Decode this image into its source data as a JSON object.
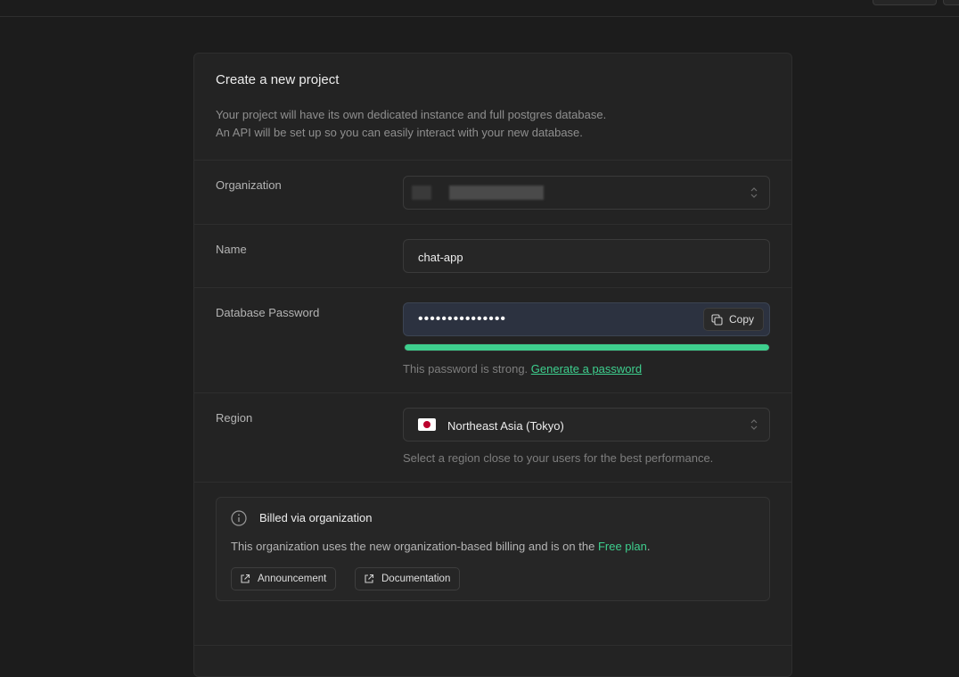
{
  "card": {
    "title": "Create a new project",
    "description_line1": "Your project will have its own dedicated instance and full postgres database.",
    "description_line2": "An API will be set up so you can easily interact with your new database."
  },
  "organization": {
    "label": "Organization",
    "value": ""
  },
  "name": {
    "label": "Name",
    "value": "chat-app"
  },
  "password": {
    "label": "Database Password",
    "value": "•••••••••••••••",
    "copy_label": "Copy",
    "strength_fraction": 1.0,
    "hint": "This password is strong.",
    "generate_link": "Generate a password",
    "strength_color": "#3ecf8e"
  },
  "region": {
    "label": "Region",
    "value": "Northeast Asia (Tokyo)",
    "flag_icon": "japan-flag-icon",
    "hint": "Select a region close to your users for the best performance."
  },
  "billing": {
    "title": "Billed via organization",
    "text_before": "This organization uses the new organization-based billing and is on the",
    "plan": "Free plan",
    "text_after": ".",
    "buttons": [
      {
        "label": "Announcement",
        "icon": "external-link-icon"
      },
      {
        "label": "Documentation",
        "icon": "external-link-icon"
      }
    ]
  },
  "colors": {
    "accent": "#3ecf8e",
    "background": "#1c1c1c",
    "card": "#232323"
  }
}
